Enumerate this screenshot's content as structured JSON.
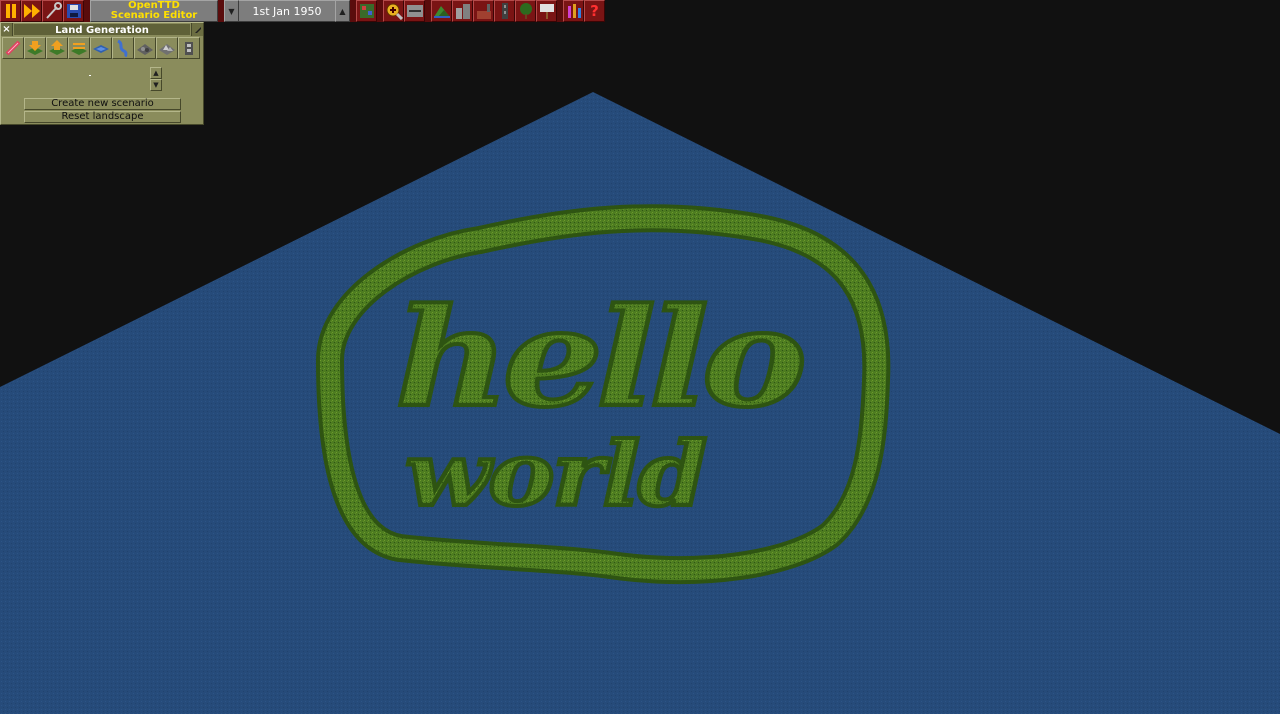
{
  "toolbar": {
    "title_line1": "OpenTTD",
    "title_line2": "Scenario Editor",
    "date": "1st Jan 1950",
    "icons": [
      "pause-icon",
      "fast-forward-icon",
      "settings-icon",
      "save-icon",
      "date-down-icon",
      "date-up-icon",
      "minimap-icon",
      "zoom-in-icon",
      "zoom-out-icon",
      "land-generation-icon",
      "town-generation-icon",
      "industry-generation-icon",
      "road-construction-icon",
      "tree-planting-icon",
      "place-sign-icon",
      "music-icon",
      "help-icon"
    ]
  },
  "land_generation": {
    "title": "Land Generation",
    "create_button": "Create new scenario",
    "reset_button": "Reset landscape",
    "tools": [
      "demolish-icon",
      "lower-land-icon",
      "raise-land-icon",
      "level-land-icon",
      "water-icon",
      "river-icon",
      "rough-land-icon",
      "rocky-land-icon",
      "transmitter-icon"
    ]
  },
  "map": {
    "terrain_text_line1": "hello",
    "terrain_text_line2": "world",
    "colors": {
      "water": "#264b7a",
      "grass": "#4d7c20",
      "background": "#111111"
    }
  }
}
